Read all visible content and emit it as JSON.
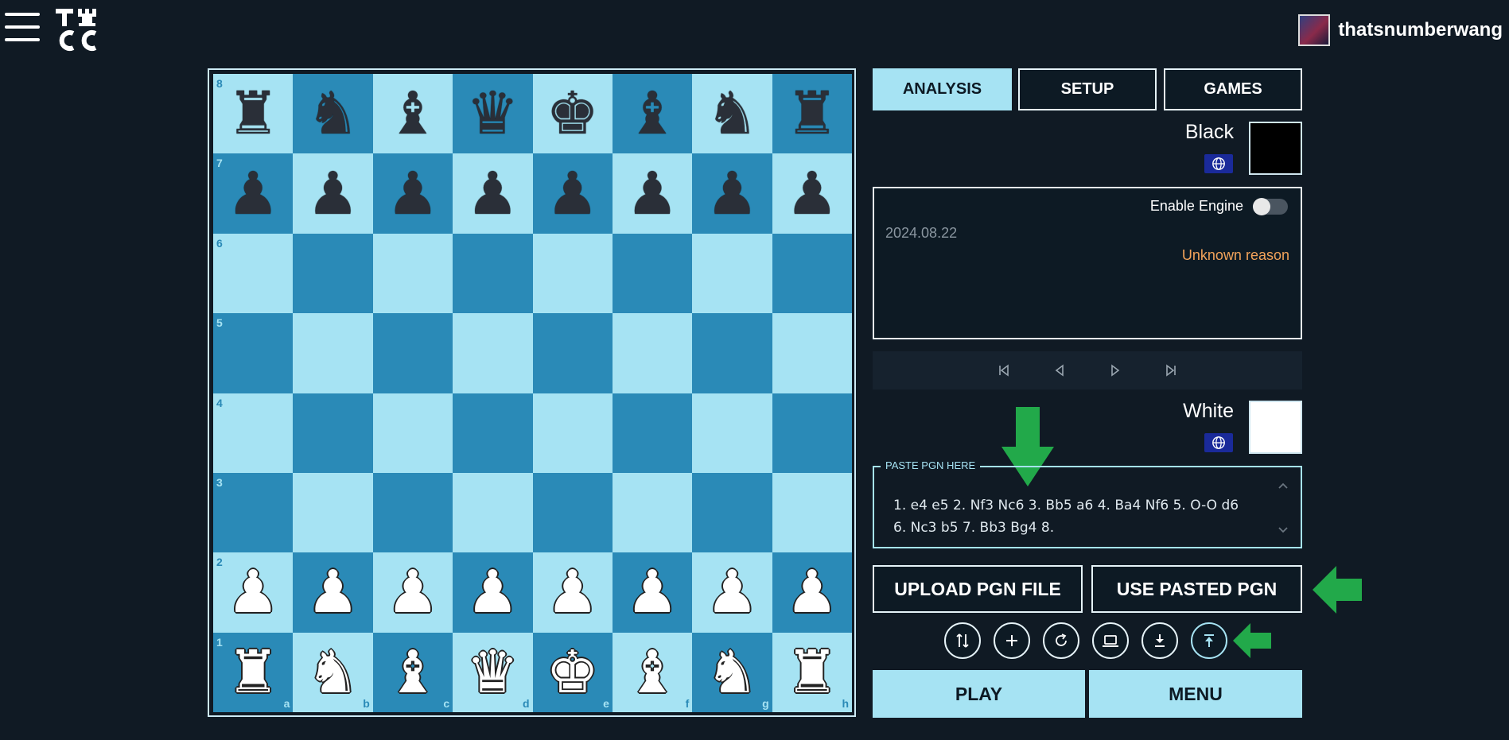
{
  "header": {
    "menu_icon": "hamburger-menu-icon",
    "logo_icon": "tcc-logo-icon",
    "username": "thatsnumberwang"
  },
  "board": {
    "ranks": [
      "8",
      "7",
      "6",
      "5",
      "4",
      "3",
      "2",
      "1"
    ],
    "files": [
      "a",
      "b",
      "c",
      "d",
      "e",
      "f",
      "g",
      "h"
    ],
    "position": [
      [
        "bR",
        "bN",
        "bB",
        "bQ",
        "bK",
        "bB",
        "bN",
        "bR"
      ],
      [
        "bP",
        "bP",
        "bP",
        "bP",
        "bP",
        "bP",
        "bP",
        "bP"
      ],
      [
        "",
        "",
        "",
        "",
        "",
        "",
        "",
        ""
      ],
      [
        "",
        "",
        "",
        "",
        "",
        "",
        "",
        ""
      ],
      [
        "",
        "",
        "",
        "",
        "",
        "",
        "",
        ""
      ],
      [
        "",
        "",
        "",
        "",
        "",
        "",
        "",
        ""
      ],
      [
        "wP",
        "wP",
        "wP",
        "wP",
        "wP",
        "wP",
        "wP",
        "wP"
      ],
      [
        "wR",
        "wN",
        "wB",
        "wQ",
        "wK",
        "wB",
        "wN",
        "wR"
      ]
    ],
    "colors": {
      "light": "#a6e3f3",
      "dark": "#2a8ab7"
    }
  },
  "tabs": [
    {
      "label": "ANALYSIS",
      "active": true
    },
    {
      "label": "SETUP",
      "active": false
    },
    {
      "label": "GAMES",
      "active": false
    }
  ],
  "black_player": {
    "name": "Black",
    "flag_icon": "globe-icon",
    "color": "#000000"
  },
  "white_player": {
    "name": "White",
    "flag_icon": "globe-icon",
    "color": "#ffffff"
  },
  "info": {
    "engine_label": "Enable Engine",
    "engine_enabled": false,
    "date": "2024.08.22",
    "result_reason": "Unknown reason"
  },
  "navigation": [
    "first-move-icon",
    "prev-move-icon",
    "next-move-icon",
    "last-move-icon"
  ],
  "pgn": {
    "legend": "PASTE PGN HERE",
    "line1": "1. e4 e5 2. Nf3 Nc6 3. Bb5 a6 4. Ba4 Nf6 5. O-O d6",
    "line2": "6. Nc3 b5 7. Bb3 Bg4 8."
  },
  "actions": {
    "upload_label": "UPLOAD PGN FILE",
    "use_pasted_label": "USE PASTED PGN",
    "play_label": "PLAY",
    "menu_label": "MENU"
  },
  "tool_icons": [
    "flip-board-icon",
    "add-icon",
    "reset-icon",
    "laptop-icon",
    "download-icon",
    "upload-icon"
  ],
  "annotations": {
    "arrow_color": "#22a94a"
  }
}
